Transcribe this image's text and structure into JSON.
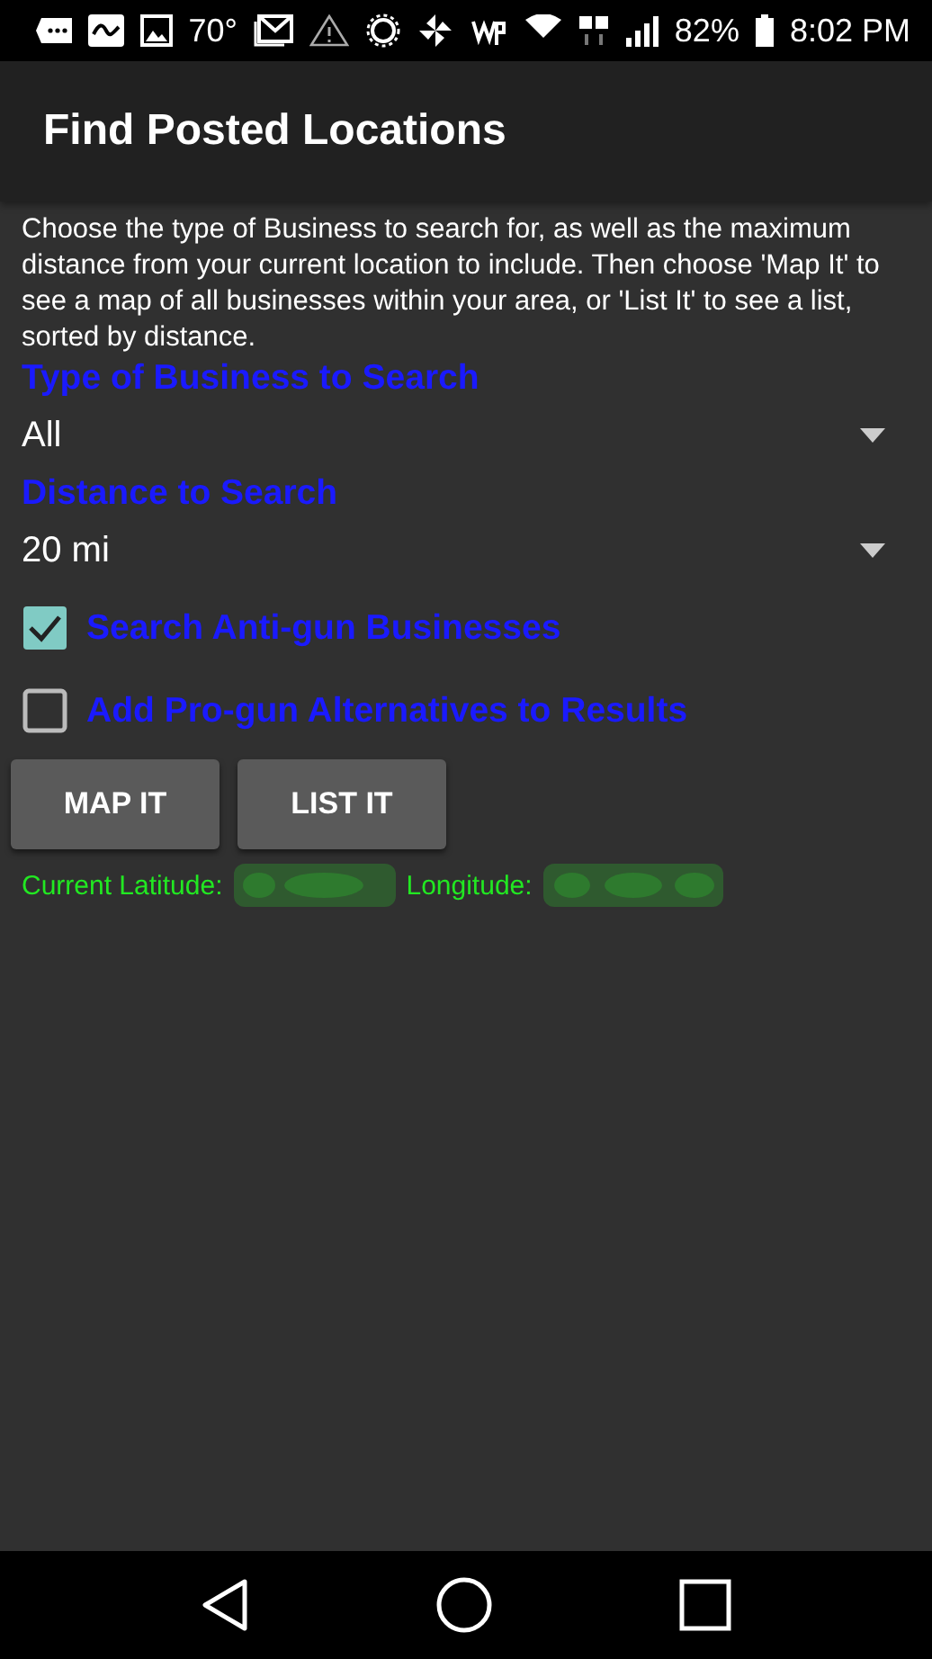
{
  "status_bar": {
    "temperature": "70°",
    "battery": "82%",
    "time": "8:02 PM"
  },
  "app_bar": {
    "title": "Find Posted Locations"
  },
  "description": "Choose the type of Business to search for, as well as the maximum distance from your current location to include.  Then choose 'Map It' to see a map of all businesses within your area, or 'List It' to see a list, sorted by distance.",
  "fields": [
    {
      "label": "Type of Business to Search",
      "value": "All"
    },
    {
      "label": "Distance to Search",
      "value": "20 mi"
    }
  ],
  "options": [
    {
      "label": "Search Anti-gun Businesses",
      "checked": true
    },
    {
      "label": "Add Pro-gun Alternatives to Results",
      "checked": false
    }
  ],
  "buttons": [
    "MAP IT",
    "LIST IT"
  ],
  "location": {
    "latitude_label": "Current Latitude:",
    "longitude_label": "Longitude:"
  }
}
